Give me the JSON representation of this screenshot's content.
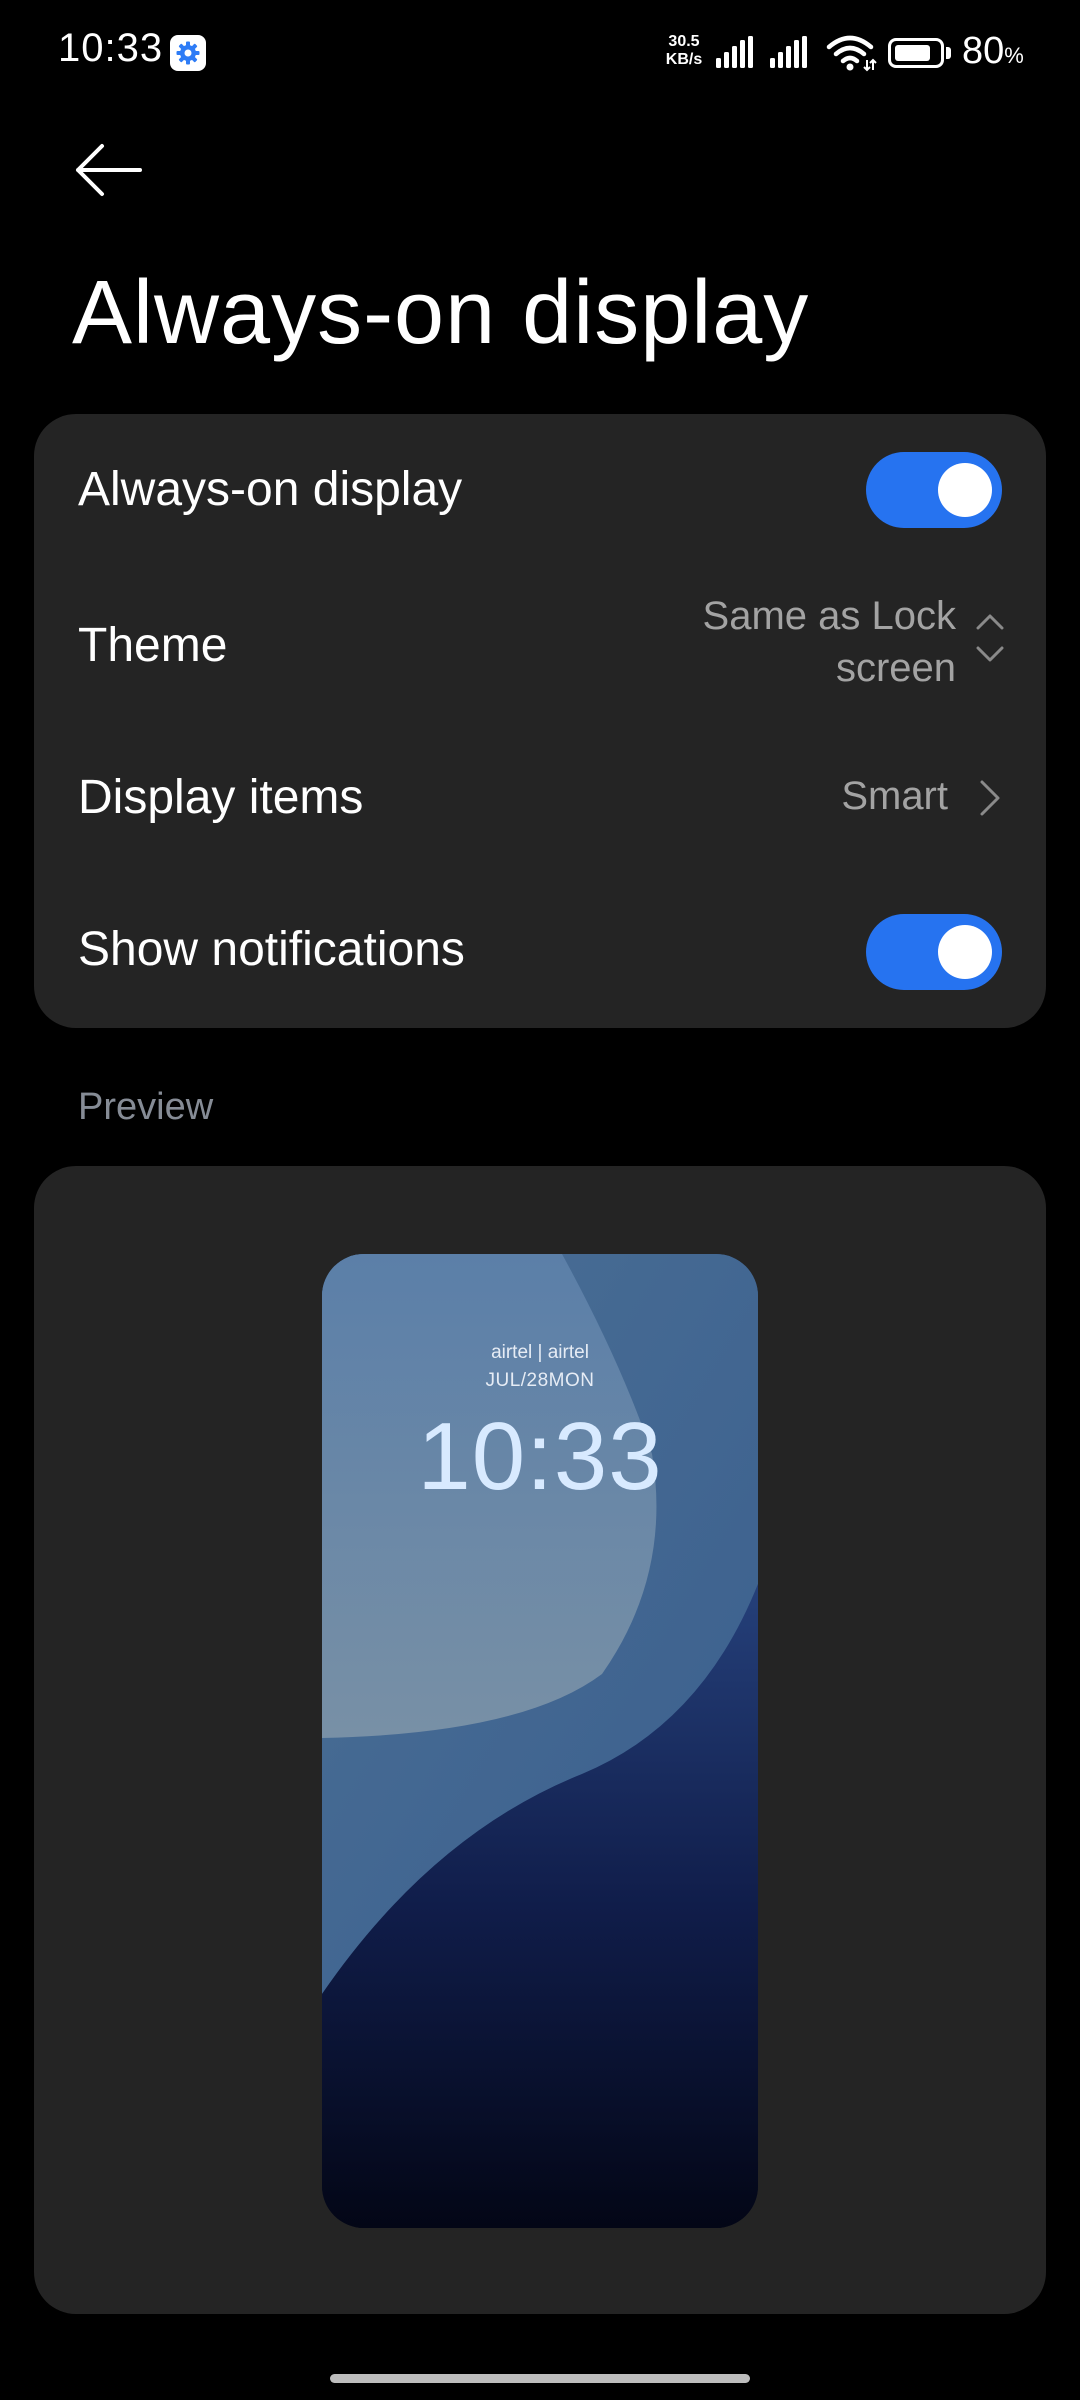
{
  "status_bar": {
    "time": "10:33",
    "net_speed_value": "30.5",
    "net_speed_unit": "KB/s",
    "battery_value": "80",
    "battery_unit": "%",
    "battery_level": 0.8,
    "app_icon": "settings-gear-icon"
  },
  "header": {
    "back_icon": "back-arrow-icon",
    "title": "Always-on display"
  },
  "settings": {
    "always_on": {
      "label": "Always-on display",
      "enabled": true
    },
    "theme": {
      "label": "Theme",
      "value_line1": "Same as Lock",
      "value_line2": "screen",
      "icon": "up-down-chevron-icon"
    },
    "display_items": {
      "label": "Display items",
      "value": "Smart",
      "icon": "chevron-right-icon"
    },
    "show_notifications": {
      "label": "Show notifications",
      "enabled": true
    }
  },
  "preview": {
    "section_label": "Preview",
    "carrier": "airtel | airtel",
    "date": "JUL/28MON",
    "clock": "10:33"
  },
  "colors": {
    "accent": "#2673f0",
    "card": "#242424",
    "background": "#000000"
  }
}
